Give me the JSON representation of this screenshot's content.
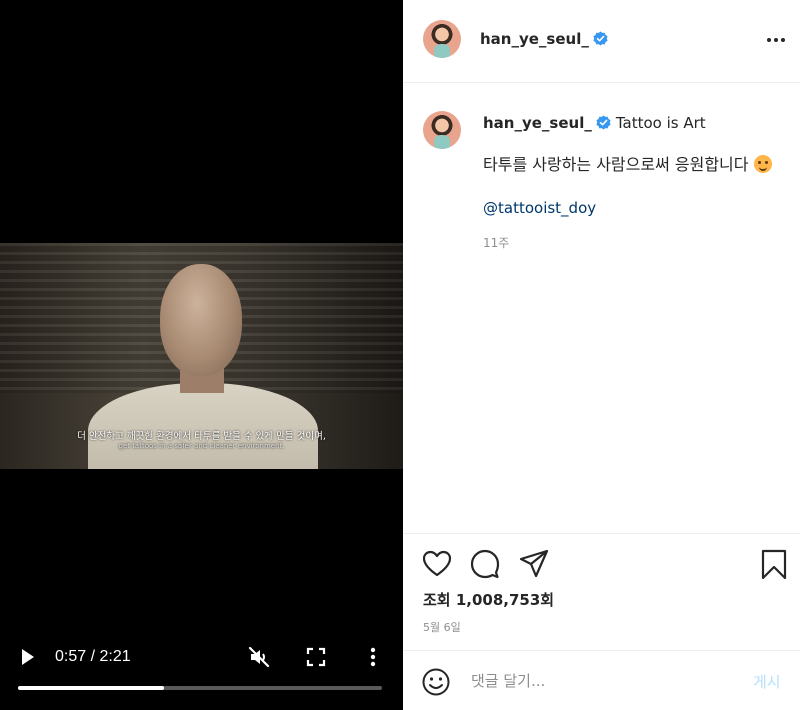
{
  "video": {
    "subtitle_ko": "더 안전하고 깨끗한 환경에서 타투를 받을 수 있게 만들 것이며,",
    "subtitle_en": "get tattoos in a safer and cleaner environment.",
    "current_time": "0:57",
    "duration": "2:21",
    "time_display": "0:57 / 2:21",
    "progress_fraction": 0.4,
    "muted": true,
    "icons": [
      "play-icon",
      "muted-speaker-icon",
      "fullscreen-icon",
      "more-vertical-icon"
    ]
  },
  "post": {
    "header": {
      "username": "han_ye_seul_",
      "verified": true
    },
    "caption": {
      "username": "han_ye_seul_",
      "title": "Tattoo is Art",
      "body": "타투를 사랑하는 사람으로써 응원합니다",
      "mention": "@tattooist_doy",
      "age": "11주"
    },
    "stats": {
      "views": "조회 1,008,753회",
      "date": "5월 6일"
    },
    "comment": {
      "placeholder": "댓글 달기...",
      "post_label": "게시"
    },
    "colors": {
      "verified_blue": "#3897f0",
      "link_blue": "#00376b",
      "post_button_disabled": "#b2dffc"
    }
  }
}
